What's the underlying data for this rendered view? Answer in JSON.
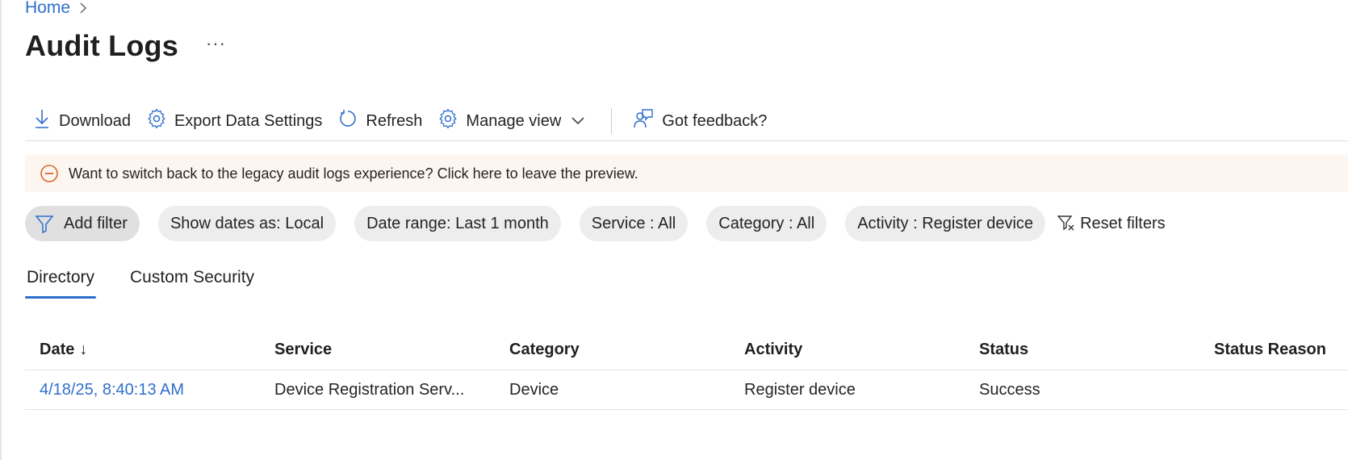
{
  "breadcrumb": {
    "home": "Home"
  },
  "page": {
    "title": "Audit Logs",
    "more": "···"
  },
  "toolbar": {
    "download": "Download",
    "export": "Export Data Settings",
    "refresh": "Refresh",
    "manage_view": "Manage view",
    "feedback": "Got feedback?"
  },
  "banner": {
    "text": "Want to switch back to the legacy audit logs experience? Click here to leave the preview."
  },
  "filters": {
    "add": "Add filter",
    "dates": "Show dates as: Local",
    "range": "Date range: Last 1 month",
    "service": "Service : All",
    "category": "Category : All",
    "activity": "Activity : Register device",
    "reset": "Reset filters"
  },
  "tabs": [
    {
      "label": "Directory",
      "active": true
    },
    {
      "label": "Custom Security",
      "active": false
    }
  ],
  "table": {
    "columns": [
      "Date",
      "Service",
      "Category",
      "Activity",
      "Status",
      "Status Reason"
    ],
    "sort_icon": "↓",
    "rows": [
      {
        "date": "4/18/25, 8:40:13 AM",
        "service": "Device Registration Serv...",
        "category": "Device",
        "activity": "Register device",
        "status": "Success",
        "status_reason": ""
      }
    ]
  },
  "colors": {
    "link": "#2f6fcc",
    "banner_bg": "#fdf6f0",
    "warning_icon": "#d9682b",
    "pill_bg": "#ededed"
  }
}
